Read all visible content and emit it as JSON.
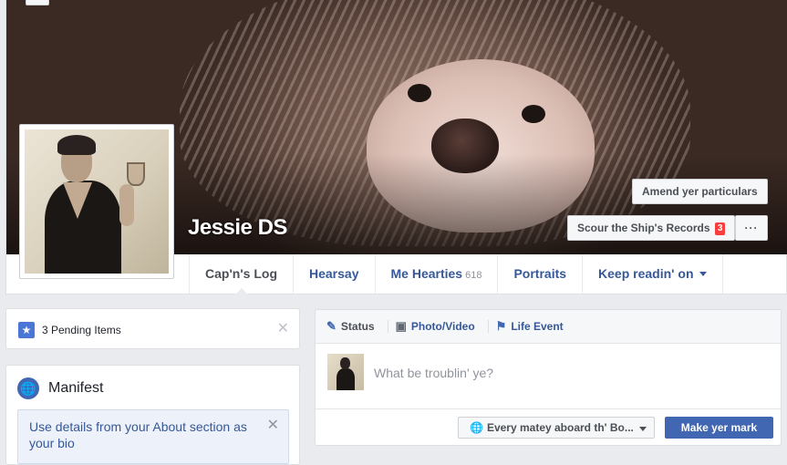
{
  "profile": {
    "name": "Jessie DS"
  },
  "cover_actions": {
    "amend_label": "Amend yer particulars",
    "scour_label": "Scour the Ship's Records",
    "scour_badge": "3",
    "more_label": "···"
  },
  "nav": {
    "tabs": [
      {
        "label": "Cap'n's Log",
        "active": true
      },
      {
        "label": "Hearsay"
      },
      {
        "label": "Me Hearties",
        "count": "618"
      },
      {
        "label": "Portraits"
      },
      {
        "label": "Keep readin' on"
      }
    ]
  },
  "pending": {
    "label": "3 Pending Items",
    "icon": "star-icon"
  },
  "manifest": {
    "title": "Manifest",
    "icon": "globe-icon",
    "bio_prompt": "Use details from your About section as your bio"
  },
  "composer": {
    "tabs": [
      {
        "label": "Status",
        "icon": "pencil-icon"
      },
      {
        "label": "Photo/Video",
        "icon": "camera-icon"
      },
      {
        "label": "Life Event",
        "icon": "flag-icon"
      }
    ],
    "placeholder": "What be troublin' ye?",
    "audience_label": "Every matey aboard th' Bo...",
    "post_label": "Make yer mark"
  },
  "colors": {
    "link": "#365899",
    "primary_button": "#4267b2",
    "badge": "#fa3e3e",
    "background": "#e9ebee"
  }
}
